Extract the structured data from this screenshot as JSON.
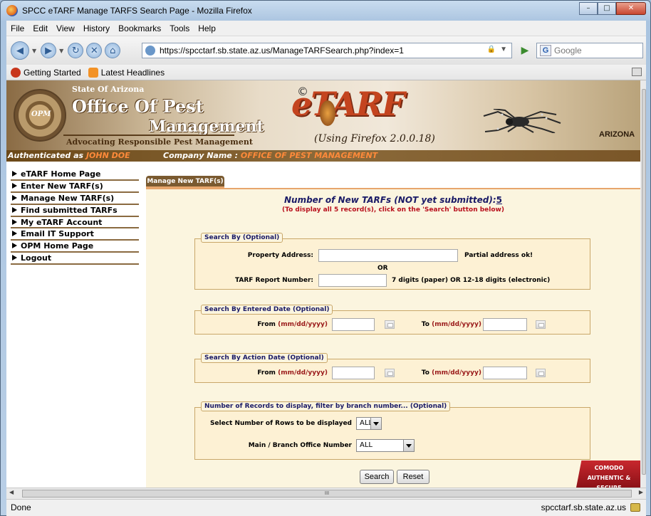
{
  "window": {
    "title": "SPCC eTARF Manage TARFS Search Page - Mozilla Firefox"
  },
  "menu": [
    "File",
    "Edit",
    "View",
    "History",
    "Bookmarks",
    "Tools",
    "Help"
  ],
  "nav": {
    "url": "https://spcctarf.sb.state.az.us/ManageTARFSearch.php?index=1",
    "search_placeholder": "Google"
  },
  "bookmarks": [
    "Getting Started",
    "Latest Headlines"
  ],
  "header": {
    "state": "State Of Arizona",
    "office_line1": "Office Of Pest",
    "office_line2": "Management",
    "tagline": "Advocating Responsible Pest Management",
    "seal": "OPM",
    "logo_text": "eTARF",
    "copyright": "©",
    "using": "(Using Firefox 2.0.0.18)",
    "az": "ARIZONA"
  },
  "auth": {
    "label": "Authenticated as",
    "user": "JOHN DOE",
    "company_label": "Company Name :",
    "company": "OFFICE OF PEST MANAGEMENT"
  },
  "sidebar": {
    "items": [
      "eTARF Home Page",
      "Enter New TARF(s)",
      "Manage New TARF(s)",
      "Find submitted TARFs",
      "My eTARF Account",
      "Email IT Support",
      "OPM Home Page",
      "Logout"
    ]
  },
  "tab": {
    "label": "Manage New TARF(s)"
  },
  "main": {
    "heading": "Number of New TARFs (NOT yet submitted):",
    "count": "5",
    "subnote": "(To display all 5 record(s), click on the 'Search' button below)"
  },
  "search_by": {
    "legend": "Search By (Optional)",
    "address_label": "Property Address:",
    "address_note": "Partial address ok!",
    "or": "OR",
    "tarf_label": "TARF Report Number:",
    "tarf_note": "7 digits (paper) OR 12-18 digits (electronic)"
  },
  "entered_date": {
    "legend": "Search By Entered Date (Optional)",
    "from_label": "From",
    "to_label": "To",
    "format": "(mm/dd/yyyy)"
  },
  "action_date": {
    "legend": "Search By Action Date (Optional)",
    "from_label": "From",
    "to_label": "To",
    "format": "(mm/dd/yyyy)"
  },
  "records": {
    "legend": "Number of Records to display, filter by branch number... (Optional)",
    "rows_label": "Select Number of Rows to be displayed",
    "rows_value": "ALL",
    "branch_label": "Main / Branch Office Number",
    "branch_value": "ALL"
  },
  "buttons": {
    "search": "Search",
    "reset": "Reset"
  },
  "badge": {
    "line1": "COMODO",
    "line2": "AUTHENTIC & SECURE"
  },
  "status": {
    "left": "Done",
    "right": "spcctarf.sb.state.az.us",
    "scroll_grip": "III"
  }
}
